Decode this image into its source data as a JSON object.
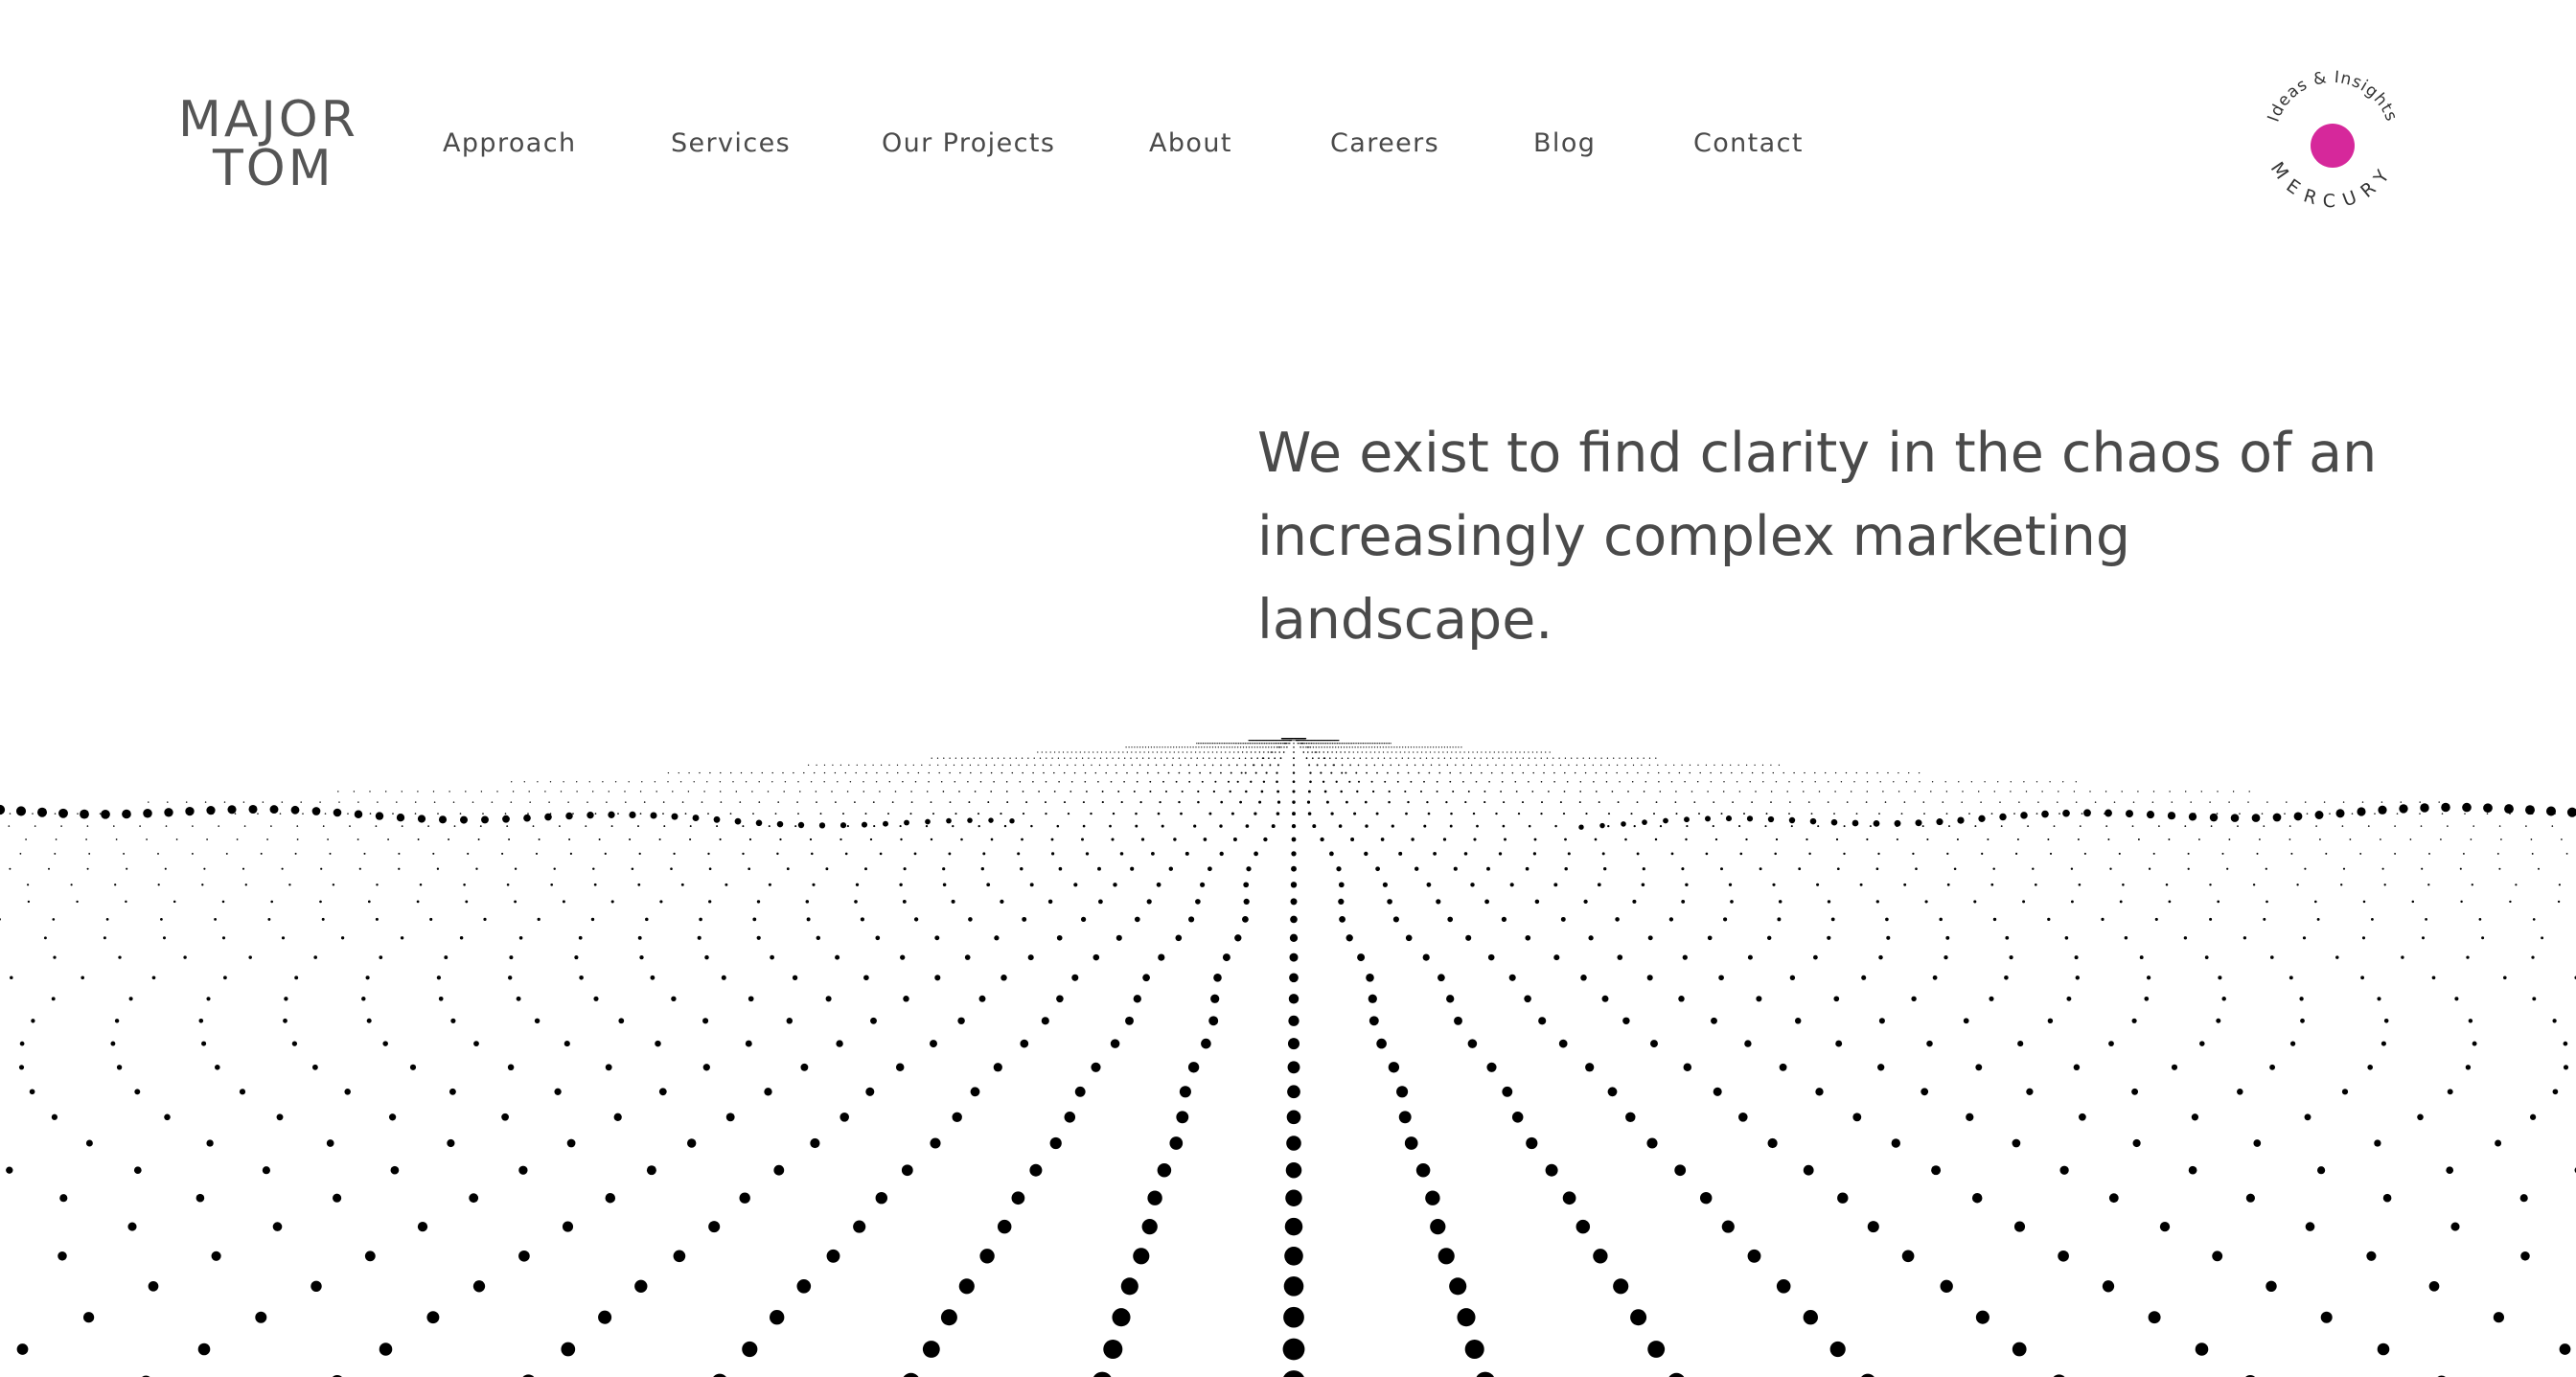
{
  "logo": {
    "line1": "MAJOR",
    "line2": "TOM"
  },
  "nav": {
    "items": [
      {
        "label": "Approach"
      },
      {
        "label": "Services"
      },
      {
        "label": "Our Projects"
      },
      {
        "label": "About"
      },
      {
        "label": "Careers"
      },
      {
        "label": "Blog"
      },
      {
        "label": "Contact"
      }
    ]
  },
  "badge": {
    "top_text": "Ideas & Insights",
    "bottom_text": "MERCURY",
    "dot_color": "#d6289b"
  },
  "hero": {
    "text": "We exist to find clarity in the chaos of an increasingly complex marketing landscape."
  },
  "colors": {
    "text": "#4a4a4a",
    "logo": "#555555",
    "dots": "#000000",
    "accent": "#d6289b"
  }
}
